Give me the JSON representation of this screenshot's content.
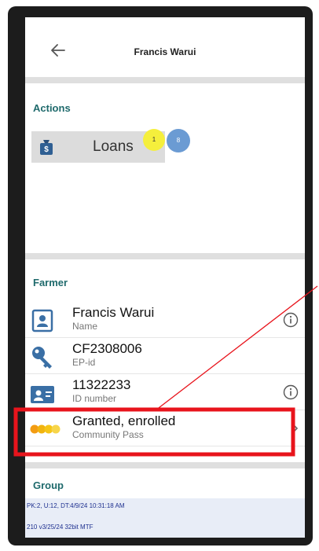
{
  "header": {
    "title": "Francis Warui"
  },
  "actions": {
    "section_title": "Actions",
    "loans_label": "Loans",
    "badge_yellow": "1",
    "badge_blue": "8"
  },
  "farmer": {
    "section_title": "Farmer",
    "rows": [
      {
        "value": "Francis Warui",
        "label": "Name"
      },
      {
        "value": "CF2308006",
        "label": "EP-id"
      },
      {
        "value": "11322233",
        "label": "ID number"
      },
      {
        "value": "Granted, enrolled",
        "label": "Community Pass"
      }
    ]
  },
  "group": {
    "section_title": "Group"
  },
  "footer": {
    "line1": "PK:2, U:12, DT:4/9/24 10:31:18 AM",
    "line2": "210 v3/25/24 32bit MTF"
  },
  "colors": {
    "accent": "#1f6a6c",
    "highlight_box": "#e8141c",
    "icon_blue": "#3a6fa5"
  }
}
